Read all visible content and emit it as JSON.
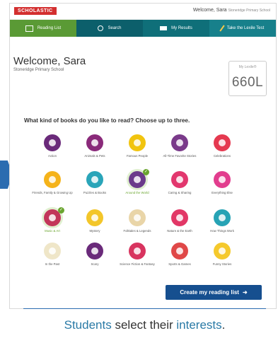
{
  "topbar": {
    "logo": "SCHOLASTIC",
    "greeting": "Welcome, Sara",
    "school": "Stoneridge Primary School"
  },
  "nav": {
    "tabs": [
      {
        "label": "Reading List",
        "icon": "book-icon",
        "color": "#5a9a35"
      },
      {
        "label": "Search",
        "icon": "search-icon",
        "color": "#0c5f6b"
      },
      {
        "label": "My Results",
        "icon": "results-icon",
        "color": "#0f6f79"
      },
      {
        "label": "Take the Lexile Test",
        "icon": "pencil-icon",
        "color": "#17808b"
      }
    ]
  },
  "welcome": {
    "title": "Welcome, Sara",
    "school": "Stoneridge Primary School"
  },
  "lexile": {
    "label": "My Lexile®",
    "value": "660L"
  },
  "question": "What kind of books do you like to read? Choose up to three.",
  "interests": [
    {
      "label": "Action",
      "color": "#6a2a7a",
      "selected": false
    },
    {
      "label": "Animals & Pets",
      "color": "#8a2a7a",
      "selected": false
    },
    {
      "label": "Famous People",
      "color": "#f1c40f",
      "selected": false
    },
    {
      "label": "All-Time Favorite Stories",
      "color": "#7a3a8a",
      "selected": false
    },
    {
      "label": "Celebrations",
      "color": "#e53950",
      "selected": false
    },
    {
      "label": "Friends, Family & Growing Up",
      "color": "#f5b31a",
      "selected": false
    },
    {
      "label": "Puzzles & Books",
      "color": "#2aa5b9",
      "selected": false
    },
    {
      "label": "Around the World",
      "color": "#6b3b8b",
      "selected": true
    },
    {
      "label": "Caring & Sharing",
      "color": "#e2376e",
      "selected": false
    },
    {
      "label": "Everything Else",
      "color": "#e23d8e",
      "selected": false
    },
    {
      "label": "Music & Art",
      "color": "#c2365a",
      "selected": true
    },
    {
      "label": "Mystery",
      "color": "#f3c62a",
      "selected": false
    },
    {
      "label": "Folktales & Legends",
      "color": "#e9d5a8",
      "selected": false
    },
    {
      "label": "Nature & the Earth",
      "color": "#e23766",
      "selected": false
    },
    {
      "label": "How Things Work",
      "color": "#27a3b5",
      "selected": false
    },
    {
      "label": "In the Past",
      "color": "#efe6c8",
      "selected": false
    },
    {
      "label": "Scary",
      "color": "#6a2a7a",
      "selected": false
    },
    {
      "label": "Science Fiction & Fantasy",
      "color": "#d8345f",
      "selected": false
    },
    {
      "label": "Sports & Games",
      "color": "#e04848",
      "selected": false
    },
    {
      "label": "Funny Stories",
      "color": "#f5c92c",
      "selected": false
    }
  ],
  "create_button": {
    "label": "Create my reading list",
    "icon": "arrow-right-icon"
  },
  "caption": {
    "part1": "Students",
    "part2": " select their ",
    "part3": "interests",
    "part4": "."
  },
  "colors": {
    "button": "#164f8f",
    "accent": "#2a7aa6",
    "selected": "#6aa52f"
  }
}
